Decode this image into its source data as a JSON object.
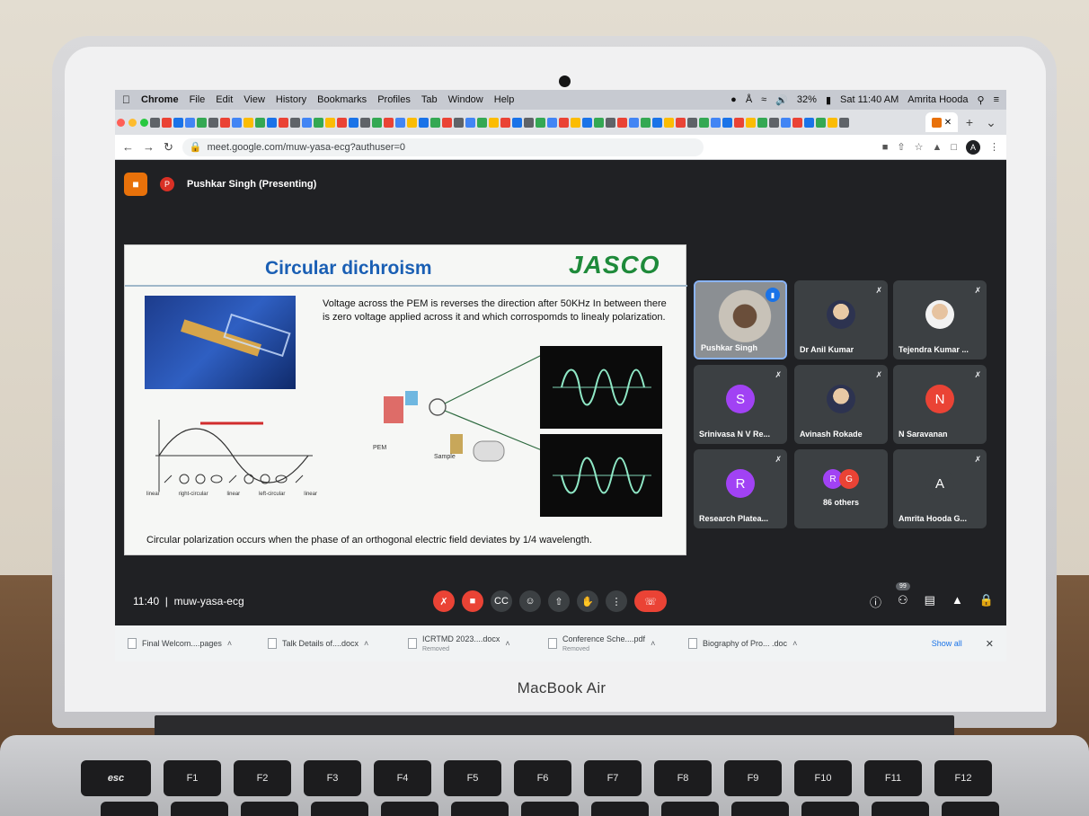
{
  "brand_label": "MacBook Air",
  "keyboard": [
    "esc",
    "F1",
    "F2",
    "F3",
    "F4",
    "F5",
    "F6",
    "F7",
    "F8",
    "F9",
    "F10",
    "F11",
    "F12"
  ],
  "menubar": {
    "app": "Chrome",
    "items": [
      "File",
      "Edit",
      "View",
      "History",
      "Bookmarks",
      "Profiles",
      "Tab",
      "Window",
      "Help"
    ],
    "battery": "32%",
    "clock": "Sat 11:40 AM",
    "user": "Amrita Hooda"
  },
  "browser": {
    "url": "meet.google.com/muw-yasa-ecg?authuser=0",
    "profile_initial": "A"
  },
  "meet": {
    "presenter_initial": "P",
    "presenter_label": "Pushkar Singh (Presenting)",
    "meeting_time": "11:40",
    "meeting_code": "muw-yasa-ecg",
    "participant_count": "99"
  },
  "slide": {
    "title": "Circular dichroism",
    "logo": "JASCO",
    "body": "Voltage across the PEM is reverses the direction after 50KHz  In between there is zero voltage applied across it and which corrospomds to linealy polarization.",
    "pem_label": "PEM",
    "sample_label": "Sample",
    "polar_labels": [
      "linear",
      "right-circular",
      "linear",
      "left-circular",
      "linear"
    ],
    "caption": "Circular polarization occurs when the phase of an orthogonal electric field deviates by 1/4 wavelength."
  },
  "participants": [
    {
      "name": "Pushkar Singh",
      "type": "video"
    },
    {
      "name": "Dr Anil Kumar",
      "type": "photo"
    },
    {
      "name": "Tejendra Kumar ...",
      "type": "photo"
    },
    {
      "name": "Srinivasa N V Re...",
      "type": "letter",
      "letter": "S",
      "color": "#a142f4"
    },
    {
      "name": "Avinash Rokade",
      "type": "photo"
    },
    {
      "name": "N Saravanan",
      "type": "letter",
      "letter": "N",
      "color": "#ea4335"
    },
    {
      "name": "Research Platea...",
      "type": "letter",
      "letter": "R",
      "color": "#a142f4"
    },
    {
      "name": "86 others",
      "type": "others",
      "letters": [
        "R",
        "G"
      ]
    },
    {
      "name": "Amrita Hooda G...",
      "type": "letter",
      "letter": "A",
      "color": "#3c4043"
    }
  ],
  "downloads": [
    {
      "name": "Final Welcom....pages",
      "status": ""
    },
    {
      "name": "Talk Details of....docx",
      "status": ""
    },
    {
      "name": "ICRTMD 2023....docx",
      "status": "Removed"
    },
    {
      "name": "Conference Sche....pdf",
      "status": "Removed"
    },
    {
      "name": "Biography of Pro... .doc",
      "status": ""
    }
  ],
  "downloads_show_all": "Show all",
  "colors": {
    "meet_bg": "#202124",
    "tile_bg": "#3c4043",
    "hangup": "#ea4335",
    "slide_title": "#1a5fb4",
    "logo_green": "#1e8a3a"
  }
}
